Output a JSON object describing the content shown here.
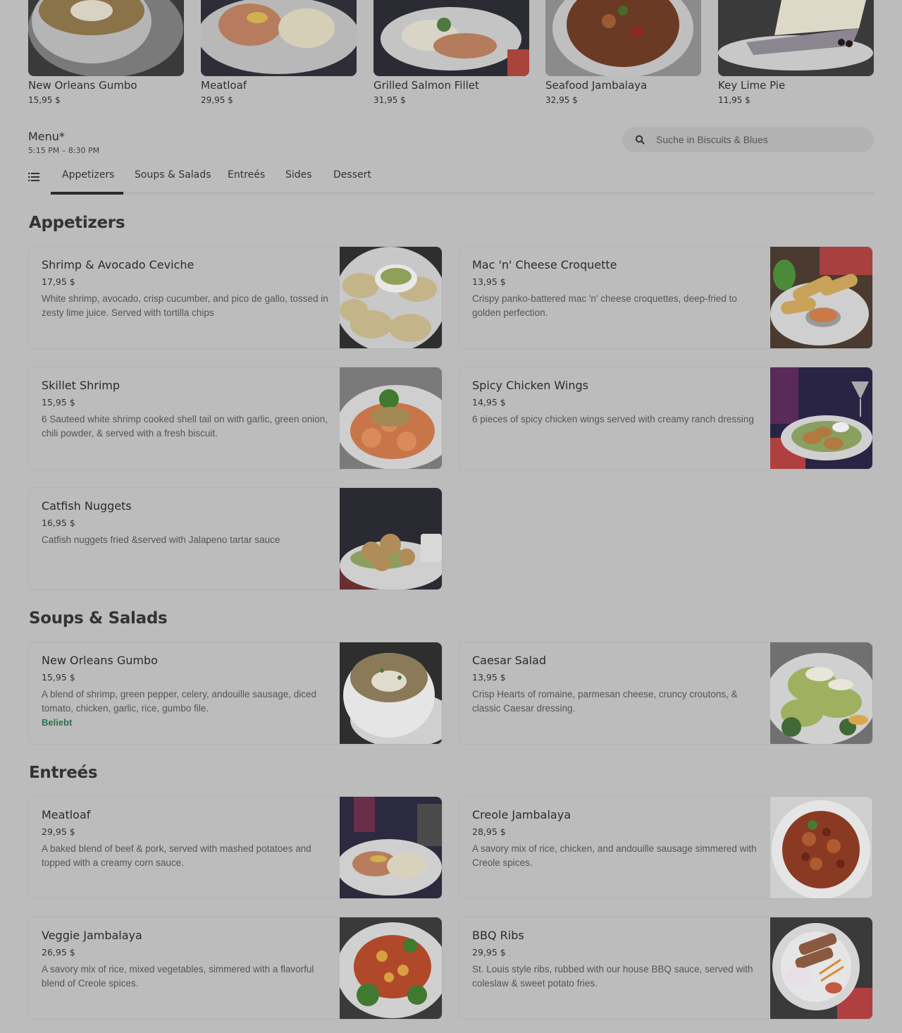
{
  "featured": [
    {
      "name": "New Orleans Gumbo",
      "price": "15,95 $",
      "image": "gumbo-bowl"
    },
    {
      "name": "Meatloaf",
      "price": "29,95 $",
      "image": "meatloaf-plate"
    },
    {
      "name": "Grilled Salmon Fillet",
      "price": "31,95 $",
      "image": "salmon-plate"
    },
    {
      "name": "Seafood Jambalaya",
      "price": "32,95 $",
      "image": "jambalaya-plate"
    },
    {
      "name": "Key Lime Pie",
      "price": "11,95 $",
      "image": "pie-slice"
    }
  ],
  "menu": {
    "title": "Menu*",
    "hours": "5:15 PM – 8:30 PM"
  },
  "search": {
    "placeholder": "Suche in Biscuits & Blues",
    "icon": "search-icon"
  },
  "tabs": [
    {
      "label": "Appetizers",
      "active": true
    },
    {
      "label": "Soups & Salads",
      "active": false
    },
    {
      "label": "Entreés",
      "active": false
    },
    {
      "label": "Sides",
      "active": false
    },
    {
      "label": "Dessert",
      "active": false
    }
  ],
  "sections": {
    "appetizers": {
      "title": "Appetizers",
      "items": [
        {
          "name": "Shrimp & Avocado Ceviche",
          "price": "17,95 $",
          "desc": "White shrimp, avocado, crisp cucumber, and pico de gallo, tossed in zesty lime juice. Served with tortilla chips"
        },
        {
          "name": "Mac 'n' Cheese Croquette",
          "price": "13,95 $",
          "desc": "Crispy panko-battered mac 'n' cheese croquettes, deep-fried to golden perfection."
        },
        {
          "name": "Skillet Shrimp",
          "price": "15,95 $",
          "desc": "6 Sauteed white shrimp cooked shell tail on with garlic, green onion, chili powder, & served with a fresh biscuit."
        },
        {
          "name": "Spicy Chicken Wings",
          "price": "14,95 $",
          "desc": "6 pieces of spicy chicken wings served with creamy ranch dressing"
        },
        {
          "name": "Catfish Nuggets",
          "price": "16,95 $",
          "desc": "Catfish nuggets fried &served with Jalapeno tartar sauce"
        }
      ]
    },
    "soups": {
      "title": "Soups & Salads",
      "items": [
        {
          "name": "New Orleans Gumbo",
          "price": "15,95 $",
          "desc": "A blend of shrimp, green pepper, celery, andouille sausage, diced tomato, chicken, garlic, rice, gumbo file.",
          "badge": "Beliebt"
        },
        {
          "name": "Caesar Salad",
          "price": "13,95 $",
          "desc": "Crisp Hearts of romaine, parmesan cheese, cruncy croutons, & classic Caesar dressing."
        }
      ]
    },
    "entrees": {
      "title": "Entreés",
      "items": [
        {
          "name": "Meatloaf",
          "price": "29,95 $",
          "desc": "A baked blend of beef & pork, served with mashed potatoes and topped with a creamy corn sauce."
        },
        {
          "name": "Creole Jambalaya",
          "price": "28,95 $",
          "desc": "A savory mix of rice, chicken, and andouille sausage simmered with Creole spices."
        },
        {
          "name": "Veggie Jambalaya",
          "price": "26,95 $",
          "desc": "A savory mix of rice, mixed vegetables, simmered with a flavorful blend of Creole spices."
        },
        {
          "name": "BBQ Ribs",
          "price": "29,95 $",
          "desc": "St. Louis style ribs, rubbed with our house BBQ sauce, served with coleslaw & sweet potato fries."
        }
      ]
    }
  }
}
